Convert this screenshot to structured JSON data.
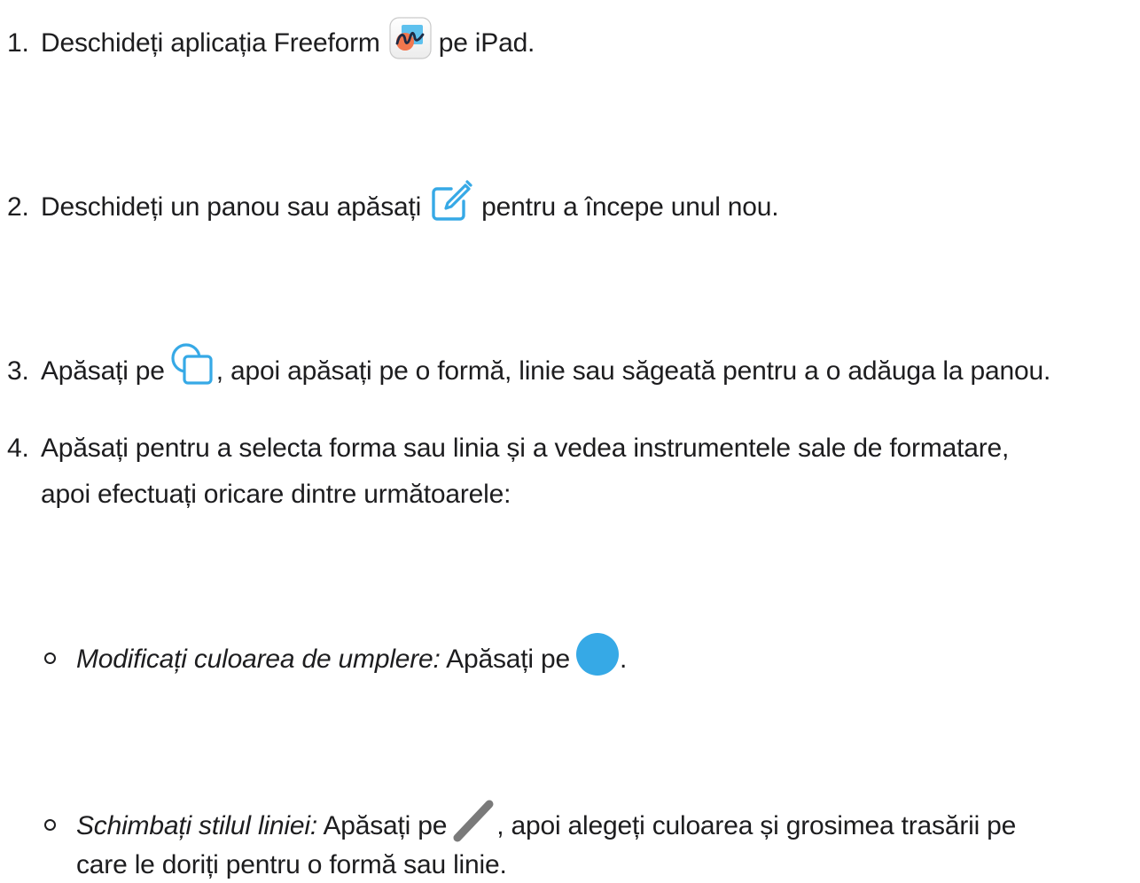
{
  "steps": [
    {
      "number": "1.",
      "before": "Deschideți aplicația Freeform",
      "icon": "freeform-app-icon",
      "after": "pe iPad."
    },
    {
      "number": "2.",
      "before": "Deschideți un panou sau apăsați",
      "icon": "compose-icon",
      "after": "pentru a începe unul nou."
    },
    {
      "number": "3.",
      "before": "Apăsați pe",
      "icon": "shapes-icon",
      "after": ", apoi apăsați pe o formă, linie sau săgeată pentru a o adăuga la panou."
    },
    {
      "number": "4.",
      "line1": "Apăsați pentru a selecta forma sau linia și a vedea instrumentele sale de formatare,",
      "line2": "apoi efectuați oricare dintre următoarele:"
    }
  ],
  "subitems": [
    {
      "label": "Modificați culoarea de umplere:",
      "before": "Apăsați pe",
      "icon": "fill-color-icon",
      "after": "."
    },
    {
      "label": "Schimbați stilul liniei:",
      "before": "Apăsați pe",
      "icon": "line-style-icon",
      "after": ", apoi alegeți culoarea și grosimea trasării pe",
      "line2": "care le doriți pentru o formă sau linie."
    }
  ],
  "colors": {
    "text": "#1d1d1f",
    "accent_blue": "#36a9e6",
    "pen_gray": "#7a7a7a"
  }
}
